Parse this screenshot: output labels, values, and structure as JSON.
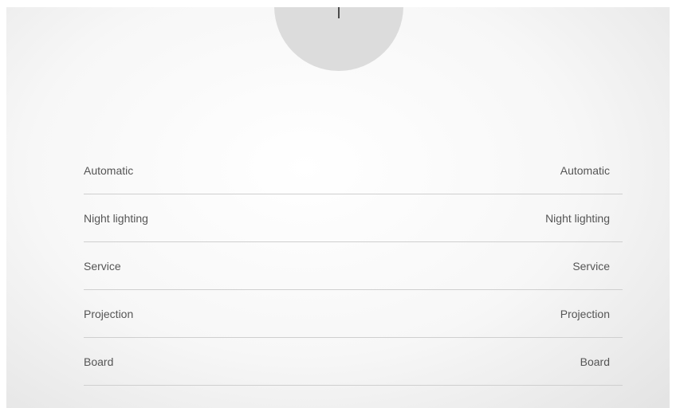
{
  "dial": {
    "icon": "dial-indicator"
  },
  "colors": {
    "dial": "#dcdcdc",
    "text": "#555555",
    "divider": "#cfcfcf"
  },
  "modes": [
    {
      "label": "Automatic",
      "value": "Automatic"
    },
    {
      "label": "Night lighting",
      "value": "Night lighting"
    },
    {
      "label": "Service",
      "value": "Service"
    },
    {
      "label": "Projection",
      "value": "Projection"
    },
    {
      "label": "Board",
      "value": "Board"
    }
  ]
}
